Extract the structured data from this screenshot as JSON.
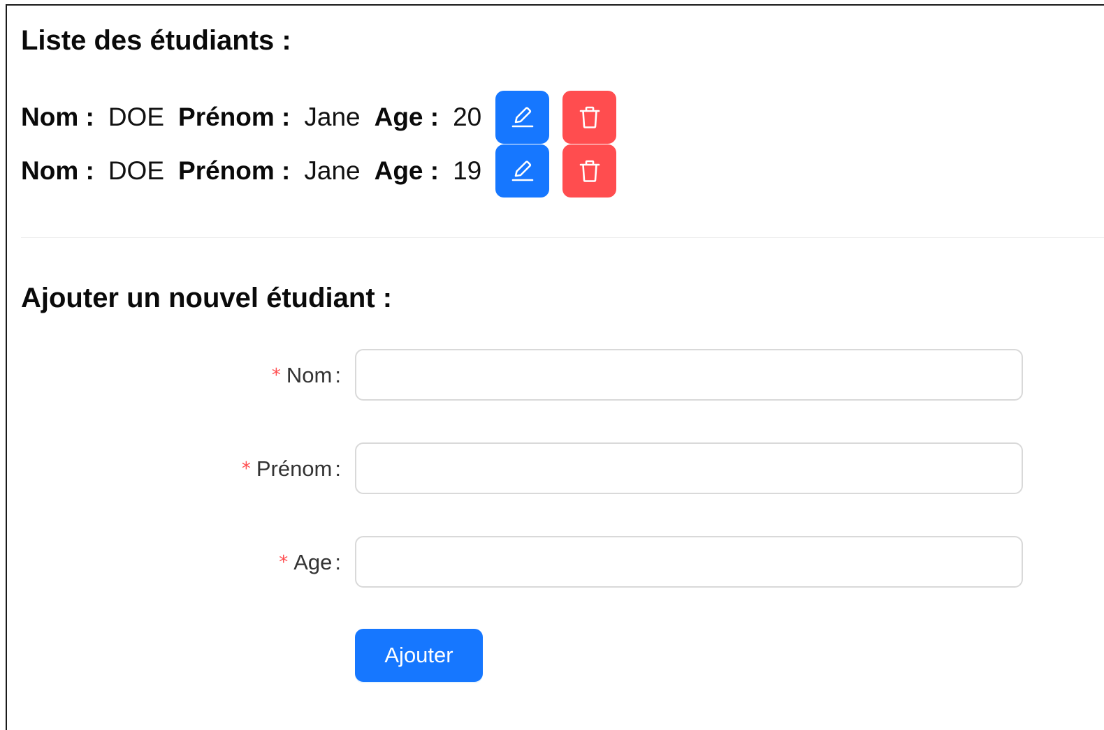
{
  "list": {
    "title": "Liste des étudiants :",
    "labels": {
      "nom": "Nom :",
      "prenom": "Prénom :",
      "age": "Age :"
    },
    "students": [
      {
        "nom": "DOE",
        "prenom": "Jane",
        "age": "20"
      },
      {
        "nom": "DOE",
        "prenom": "Jane",
        "age": "19"
      }
    ],
    "edit_icon": "edit-icon",
    "delete_icon": "delete-icon"
  },
  "form": {
    "title": "Ajouter un nouvel étudiant :",
    "required_mark": "*",
    "colon": ":",
    "fields": [
      {
        "label": "Nom",
        "value": ""
      },
      {
        "label": "Prénom",
        "value": ""
      },
      {
        "label": "Age",
        "value": ""
      }
    ],
    "submit_label": "Ajouter"
  },
  "colors": {
    "primary": "#1677ff",
    "danger": "#ff4d4f",
    "required": "#ff4d4f"
  }
}
